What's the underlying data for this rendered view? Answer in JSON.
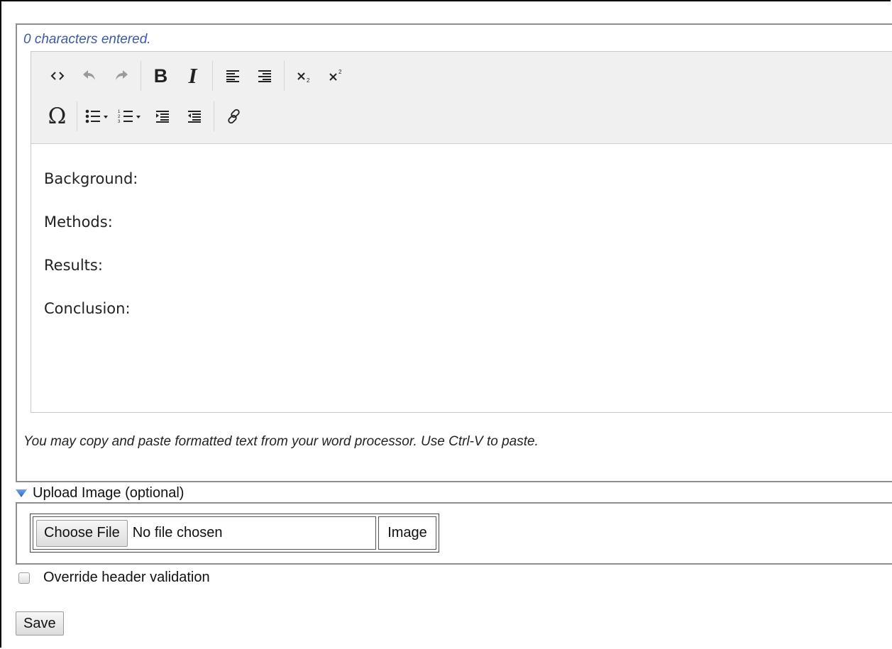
{
  "editor": {
    "char_count": "0 characters entered.",
    "toolbar": {
      "row1": [
        "source-icon",
        "undo-icon",
        "redo-icon",
        "bold-icon",
        "italic-icon",
        "align-left-icon",
        "align-right-icon",
        "subscript-icon",
        "superscript-icon"
      ],
      "row2": [
        "special-character-icon",
        "bulleted-list-icon",
        "numbered-list-icon",
        "indent-icon",
        "outdent-icon",
        "link-icon"
      ],
      "bold_glyph": "B",
      "italic_glyph": "I",
      "omega_glyph": "Ω"
    },
    "content": [
      "Background:",
      "Methods:",
      "Results:",
      "Conclusion:"
    ],
    "hint": "You may copy and paste formatted text from your word processor. Use Ctrl-V to paste."
  },
  "upload": {
    "toggle_label": "Upload Image (optional)",
    "choose_file_label": "Choose File",
    "file_status": "No file chosen",
    "image_label": "Image"
  },
  "override": {
    "label": "Override header validation",
    "checked": false
  },
  "save_label": "Save"
}
